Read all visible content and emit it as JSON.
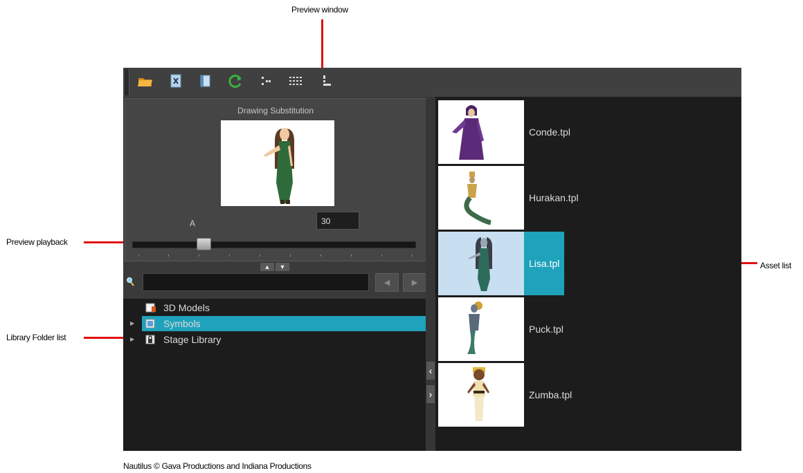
{
  "callouts": {
    "preview_window": "Preview window",
    "preview_playback": "Preview playback",
    "library_folder_list": "Library Folder list",
    "asset_list": "Asset list",
    "accent": "#e01010"
  },
  "credit": "Nautilus © Gava Productions and Indiana Productions",
  "toolbar": {
    "buttons": [
      {
        "icon": "open-folder-icon"
      },
      {
        "icon": "close-library-icon"
      },
      {
        "icon": "new-folder-icon"
      },
      {
        "icon": "refresh-icon"
      },
      {
        "icon": "details-view-icon"
      },
      {
        "icon": "list-view-icon"
      },
      {
        "icon": "thumbnails-view-icon"
      }
    ]
  },
  "preview": {
    "title": "Drawing Substitution",
    "frame_label": "A",
    "frame_value": "30",
    "playback_position": 0.24
  },
  "search": {
    "value": "",
    "prev_icon": "◀",
    "next_icon": "▶"
  },
  "folders": [
    {
      "label": "3D Models",
      "icon": "3d-models-folder-icon",
      "expandable": false,
      "selected": false
    },
    {
      "label": "Symbols",
      "icon": "symbols-folder-icon",
      "expandable": true,
      "selected": true
    },
    {
      "label": "Stage Library",
      "icon": "stage-library-folder-icon",
      "expandable": true,
      "selected": false
    }
  ],
  "assets": [
    {
      "name": "Conde.tpl",
      "selected": false
    },
    {
      "name": "Hurakan.tpl",
      "selected": false
    },
    {
      "name": "Lisa.tpl",
      "selected": true
    },
    {
      "name": "Puck.tpl",
      "selected": false
    },
    {
      "name": "Zumba.tpl",
      "selected": false
    }
  ],
  "colors": {
    "selection": "#1fa2bb",
    "panel_bg": "#3c3c3c",
    "list_bg": "#1c1c1c"
  }
}
